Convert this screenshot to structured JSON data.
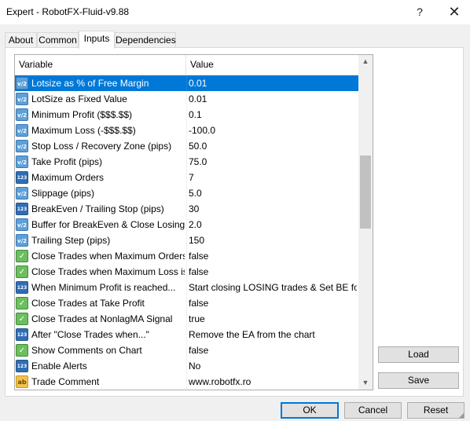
{
  "window": {
    "title": "Expert - RobotFX-Fluid-v9.88",
    "help_glyph": "?",
    "close_glyph": "✕"
  },
  "tabs": [
    {
      "label": "About"
    },
    {
      "label": "Common"
    },
    {
      "label": "Inputs",
      "active": true
    },
    {
      "label": "Dependencies"
    }
  ],
  "grid": {
    "col_variable": "Variable",
    "col_value": "Value",
    "rows": [
      {
        "type": "double",
        "icon": "v/2",
        "name": "Lotsize as % of Free Margin",
        "value": "0.01",
        "selected": true
      },
      {
        "type": "double",
        "icon": "v/2",
        "name": "LotSize as Fixed Value",
        "value": "0.01"
      },
      {
        "type": "double",
        "icon": "v/2",
        "name": "Minimum Profit ($$$.$$)",
        "value": "0.1"
      },
      {
        "type": "double",
        "icon": "v/2",
        "name": "Maximum Loss (-$$$.$$)",
        "value": "-100.0"
      },
      {
        "type": "double",
        "icon": "v/2",
        "name": "Stop Loss / Recovery Zone (pips)",
        "value": "50.0"
      },
      {
        "type": "double",
        "icon": "v/2",
        "name": "Take Profit (pips)",
        "value": "75.0"
      },
      {
        "type": "int",
        "icon": "123",
        "name": "Maximum Orders",
        "value": "7"
      },
      {
        "type": "double",
        "icon": "v/2",
        "name": "Slippage (pips)",
        "value": "5.0"
      },
      {
        "type": "int",
        "icon": "123",
        "name": "BreakEven / Trailing Stop (pips)",
        "value": "30"
      },
      {
        "type": "double",
        "icon": "v/2",
        "name": "Buffer for BreakEven & Close Losing Tr...",
        "value": "2.0"
      },
      {
        "type": "double",
        "icon": "v/2",
        "name": "Trailing Step (pips)",
        "value": "150"
      },
      {
        "type": "bool",
        "icon": "✓",
        "name": "Close Trades when Maximum Orders is...",
        "value": "false"
      },
      {
        "type": "bool",
        "icon": "✓",
        "name": "Close Trades when Maximum Loss is r...",
        "value": "false"
      },
      {
        "type": "int",
        "icon": "123",
        "name": "When Minimum Profit is reached...",
        "value": "Start closing LOSING trades & Set BE for ..."
      },
      {
        "type": "bool",
        "icon": "✓",
        "name": "Close Trades at Take Profit",
        "value": "false"
      },
      {
        "type": "bool",
        "icon": "✓",
        "name": "Close Trades at NonlagMA Signal",
        "value": "true"
      },
      {
        "type": "int",
        "icon": "123",
        "name": "After \"Close Trades when...\"",
        "value": "Remove the EA from the chart"
      },
      {
        "type": "bool",
        "icon": "✓",
        "name": "Show Comments on Chart",
        "value": "false"
      },
      {
        "type": "int",
        "icon": "123",
        "name": "Enable Alerts",
        "value": "No"
      },
      {
        "type": "str",
        "icon": "ab",
        "name": "Trade Comment",
        "value": "www.robotfx.ro"
      }
    ]
  },
  "scrollbar": {
    "up_glyph": "▲",
    "down_glyph": "▼",
    "position_fraction": 0.37
  },
  "buttons": {
    "load": "Load",
    "save": "Save",
    "ok": "OK",
    "cancel": "Cancel",
    "reset": "Reset"
  },
  "colors": {
    "selection": "#0078d7",
    "ok_border": "#0078d7"
  }
}
